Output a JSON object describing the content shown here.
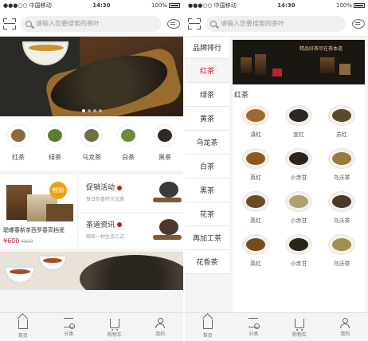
{
  "left": {
    "status": {
      "carrier": "●●●○○ 中国移动",
      "time": "14:30",
      "battery": "100%"
    },
    "search": {
      "placeholder": "请输入您要搜索的茶叶"
    },
    "categories": [
      {
        "label": "红茶",
        "color": "#8a6a3e"
      },
      {
        "label": "绿茶",
        "color": "#5e7a2e"
      },
      {
        "label": "乌龙茶",
        "color": "#6f7142"
      },
      {
        "label": "白茶",
        "color": "#6c8a3a"
      },
      {
        "label": "黑茶",
        "color": "#2f2a22"
      }
    ],
    "promo": {
      "hot_badge": "畅销",
      "product_title": "聪螺春新茶西罗春高档瓷",
      "price": "¥600",
      "old_price": "¥800"
    },
    "activity": {
      "title": "促销活动",
      "subtitle": "每日惊喜特大优惠"
    },
    "news": {
      "title": "茶道资讯",
      "subtitle": "喝茶一种生活方式"
    }
  },
  "right": {
    "status": {
      "carrier": "●●●○○ 中国移动",
      "time": "14:30",
      "battery": "100%"
    },
    "search": {
      "placeholder": "请输入您要搜索的茶叶"
    },
    "sidebar": [
      "品牌排行",
      "红茶",
      "绿茶",
      "黄茶",
      "乌龙茶",
      "白茶",
      "黑茶",
      "花茶",
      "再加工茶",
      "花香茶"
    ],
    "active_index": 1,
    "banner_text": "精品好茶尽在茶本道",
    "section_title": "红茶",
    "products": [
      {
        "label": "滇红",
        "color": "#a06a2a"
      },
      {
        "label": "宣红",
        "color": "#2e2620"
      },
      {
        "label": "苏红",
        "color": "#5a4a2c"
      },
      {
        "label": "英红",
        "color": "#8a5a22"
      },
      {
        "label": "小赤甘",
        "color": "#2a241c"
      },
      {
        "label": "乌沃茶",
        "color": "#9a7a3c"
      },
      {
        "label": "英红",
        "color": "#6a4a22"
      },
      {
        "label": "小赤甘",
        "color": "#b0a070"
      },
      {
        "label": "乌沃茶",
        "color": "#4a3a22"
      },
      {
        "label": "英红",
        "color": "#7a4a1c"
      },
      {
        "label": "小赤甘",
        "color": "#2a2418"
      },
      {
        "label": "乌沃茶",
        "color": "#a0904a"
      }
    ]
  },
  "tabbar": [
    {
      "label": "首页",
      "icon": "home-icon"
    },
    {
      "label": "分类",
      "icon": "category-icon"
    },
    {
      "label": "购物车",
      "icon": "cart-icon"
    },
    {
      "label": "我的",
      "icon": "user-icon"
    }
  ]
}
